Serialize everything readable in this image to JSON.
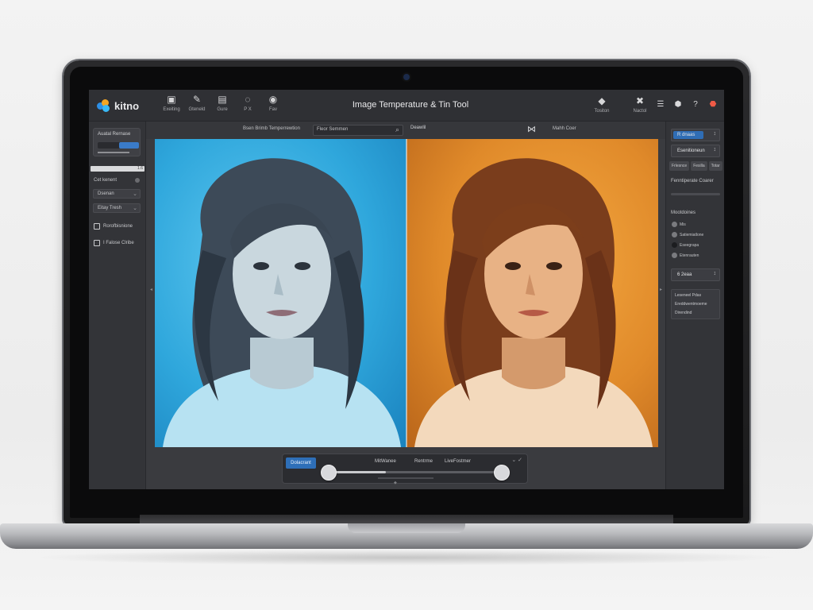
{
  "app": {
    "name": "kitno",
    "title": "Image Temperature & Tin Tool"
  },
  "toolbar": {
    "tools": [
      {
        "label": "Exeiting",
        "icon": "image-icon"
      },
      {
        "label": "Gteneld",
        "icon": "brush-icon"
      },
      {
        "label": "Gure",
        "icon": "picture-icon"
      },
      {
        "label": "P X",
        "icon": "circle-icon"
      },
      {
        "label": "Fav",
        "icon": "pin-icon"
      }
    ],
    "right_tools": [
      {
        "label": "Tositon",
        "icon": "layers-icon"
      },
      {
        "label": "Nactol",
        "icon": "wrench-icon"
      }
    ],
    "system_icons": [
      "menu-icon",
      "shield-icon",
      "help-icon",
      "alert-icon"
    ]
  },
  "left_panel": {
    "box_title": "Auatal Rernase",
    "slider_value": "1.6",
    "label_1": "Cet kenent",
    "select_1": "Dsenan",
    "select_2": "Eitay Tresh",
    "checkbox_1": "Rorofbisnione",
    "checkbox_2": "I Falose Clribe"
  },
  "canvas_top": {
    "label": "Bsen Brimb Temperrewtion",
    "search_placeholder": "Fleor Semmen",
    "label_2": "Deawlil",
    "compare_label": "Mahh Coer"
  },
  "bottom_bar": {
    "button_label": "Dolacrant",
    "label_1": "MitWanee",
    "label_2": "Rentrme",
    "label_3": "LiveFostmer",
    "warm_level": 0.33
  },
  "right_panel": {
    "select_1": "R dnaas",
    "select_2": "Esenitioneun",
    "tabs": [
      "Frlesnce",
      "Fesilla",
      "Totar"
    ],
    "label_1": "Fenntiperate Coarer",
    "label_2": "Mootdoines",
    "radios": [
      "Mis",
      "Satiemiatlone",
      "Eseegrapa",
      "Etenrauten"
    ],
    "select_3": "6 2eaa",
    "notes": [
      "Leseneel Pdas",
      "Ereddwentmoeme",
      "Direndind"
    ]
  },
  "colors": {
    "accent": "#2e6fb8",
    "cool_tone": "#2fa7dc",
    "warm_tone": "#e08a2a",
    "panel": "#333438"
  }
}
